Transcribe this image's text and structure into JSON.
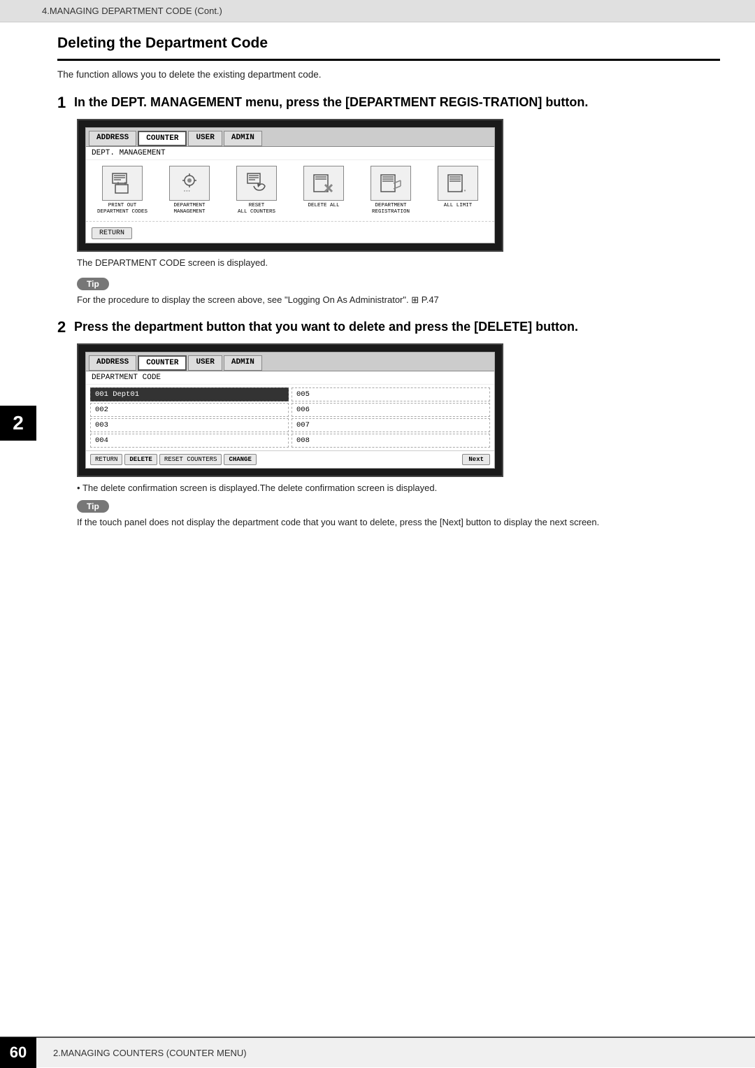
{
  "header": {
    "breadcrumb": "4.MANAGING DEPARTMENT CODE (Cont.)"
  },
  "section": {
    "title": "Deleting the Department Code",
    "intro": "The function allows you to delete the existing department code."
  },
  "step1": {
    "number": "1",
    "text": "In the DEPT. MANAGEMENT menu, press the [DEPARTMENT REGIS-TRATION] button.",
    "screen": {
      "tabs": [
        "ADDRESS",
        "COUNTER",
        "USER",
        "ADMIN"
      ],
      "active_tab": "COUNTER",
      "screen_label": "DEPT. MANAGEMENT",
      "icons": [
        {
          "label": "PRINT OUT\nDEPARTMENT CODES",
          "symbol": "🖨"
        },
        {
          "label": "DEPARTMENT\nMANAGEMENT",
          "symbol": "🔑"
        },
        {
          "label": "RESET\nALL COUNTERS",
          "symbol": "📋"
        },
        {
          "label": "DELETE ALL",
          "symbol": "🗂"
        },
        {
          "label": "DEPARTMENT\nREGISTRATION",
          "symbol": "📝"
        },
        {
          "label": "ALL LIMIT",
          "symbol": "📄"
        }
      ],
      "return_btn": "RETURN"
    },
    "note": "The DEPARTMENT CODE screen is displayed."
  },
  "tip1": {
    "badge": "Tip",
    "text": "For the procedure to display the screen above, see \"Logging On As Administrator\".  ⊞ P.47"
  },
  "step2": {
    "number": "2",
    "text": "Press the department button that you want to delete and press the [DELETE] button.",
    "screen": {
      "tabs": [
        "ADDRESS",
        "COUNTER",
        "USER",
        "ADMIN"
      ],
      "active_tab": "COUNTER",
      "screen_label": "DEPARTMENT CODE",
      "col1": [
        {
          "code": "001 Dept01",
          "selected": true
        },
        {
          "code": "002",
          "selected": false
        },
        {
          "code": "003",
          "selected": false
        },
        {
          "code": "004",
          "selected": false
        }
      ],
      "col2": [
        {
          "code": "005",
          "selected": false
        },
        {
          "code": "006",
          "selected": false
        },
        {
          "code": "007",
          "selected": false
        },
        {
          "code": "008",
          "selected": false
        }
      ],
      "buttons": [
        "RETURN",
        "DELETE",
        "RESET COUNTERS",
        "CHANGE"
      ],
      "next_btn": "Next"
    },
    "note": "The delete confirmation screen is displayed."
  },
  "tip2": {
    "badge": "Tip",
    "text": "If the touch panel does not display the department code that you want to delete, press the [Next] button to display the next screen."
  },
  "footer": {
    "page_num": "60",
    "label": "2.MANAGING COUNTERS (COUNTER MENU)"
  }
}
